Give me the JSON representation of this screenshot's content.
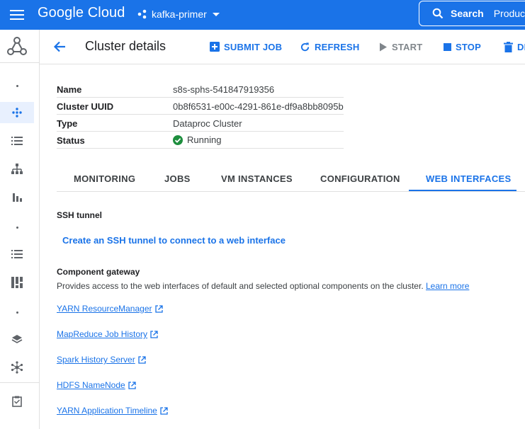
{
  "topbar": {
    "brand": "Google Cloud",
    "project": "kafka-primer",
    "search_label": "Search",
    "search_hint": "Produc"
  },
  "header": {
    "title": "Cluster details",
    "actions": {
      "submit_job": "SUBMIT JOB",
      "refresh": "REFRESH",
      "start": "START",
      "stop": "STOP",
      "delete": "DE"
    }
  },
  "details": {
    "rows": [
      {
        "key": "Name",
        "value": "s8s-sphs-541847919356"
      },
      {
        "key": "Cluster UUID",
        "value": "0b8f6531-e00c-4291-861e-df9a8bb8095b"
      },
      {
        "key": "Type",
        "value": "Dataproc Cluster"
      },
      {
        "key": "Status",
        "value": "Running"
      }
    ]
  },
  "tabs": [
    "MONITORING",
    "JOBS",
    "VM INSTANCES",
    "CONFIGURATION",
    "WEB INTERFACES"
  ],
  "active_tab": "WEB INTERFACES",
  "ssh": {
    "title": "SSH tunnel",
    "link": "Create an SSH tunnel to connect to a web interface"
  },
  "gateway": {
    "title": "Component gateway",
    "description": "Provides access to the web interfaces of default and selected optional components on the cluster.",
    "learn_more": "Learn more",
    "links": [
      "YARN ResourceManager",
      "MapReduce Job History",
      "Spark History Server",
      "HDFS NameNode",
      "YARN Application Timeline"
    ]
  },
  "colors": {
    "brand_blue": "#1a73e8",
    "status_green": "#1e8e3e",
    "disabled_grey": "#80868b"
  }
}
